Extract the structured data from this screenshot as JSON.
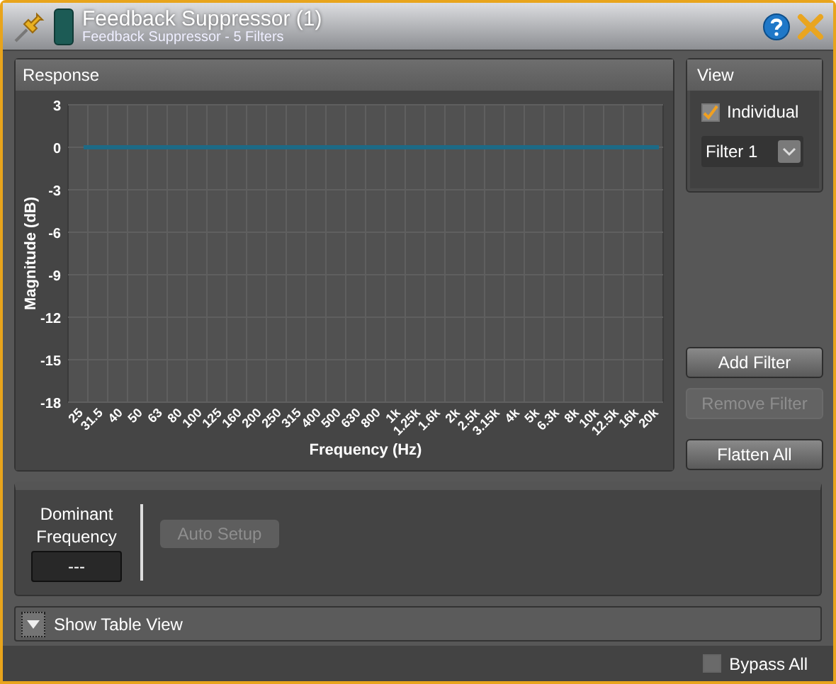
{
  "window": {
    "title": "Feedback Suppressor (1)",
    "subtitle": "Feedback Suppressor - 5 Filters"
  },
  "response": {
    "title": "Response",
    "chart_data": {
      "type": "line",
      "xlabel": "Frequency (Hz)",
      "ylabel": "Magnitude (dB)",
      "categories": [
        "25",
        "31.5",
        "40",
        "50",
        "63",
        "80",
        "100",
        "125",
        "160",
        "200",
        "250",
        "315",
        "400",
        "500",
        "630",
        "800",
        "1k",
        "1.25k",
        "1.6k",
        "2k",
        "2.5k",
        "3.15k",
        "4k",
        "5k",
        "6.3k",
        "8k",
        "10k",
        "12.5k",
        "16k",
        "20k"
      ],
      "series": [
        {
          "color": "#1d6a86",
          "values": [
            0,
            0,
            0,
            0,
            0,
            0,
            0,
            0,
            0,
            0,
            0,
            0,
            0,
            0,
            0,
            0,
            0,
            0,
            0,
            0,
            0,
            0,
            0,
            0,
            0,
            0,
            0,
            0,
            0,
            0
          ]
        }
      ],
      "grid": true,
      "ylim": [
        -18,
        3
      ],
      "yticks": [
        3,
        0,
        -3,
        -6,
        -9,
        -12,
        -15,
        -18
      ]
    }
  },
  "view": {
    "title": "View",
    "individual": {
      "label": "Individual",
      "checked": true
    },
    "filter_select": {
      "value": "Filter 1"
    }
  },
  "filter_buttons": [
    {
      "label": "Add Filter",
      "disabled": false
    },
    {
      "label": "Remove Filter",
      "disabled": true
    },
    {
      "label": "Flatten All",
      "disabled": false
    }
  ],
  "dominant": {
    "label": "Dominant Frequency",
    "value": "---"
  },
  "auto_setup": {
    "label": "Auto Setup",
    "disabled": true
  },
  "table_view": {
    "label": "Show Table View",
    "expanded": false
  },
  "bypass": {
    "label": "Bypass All",
    "checked": false
  }
}
